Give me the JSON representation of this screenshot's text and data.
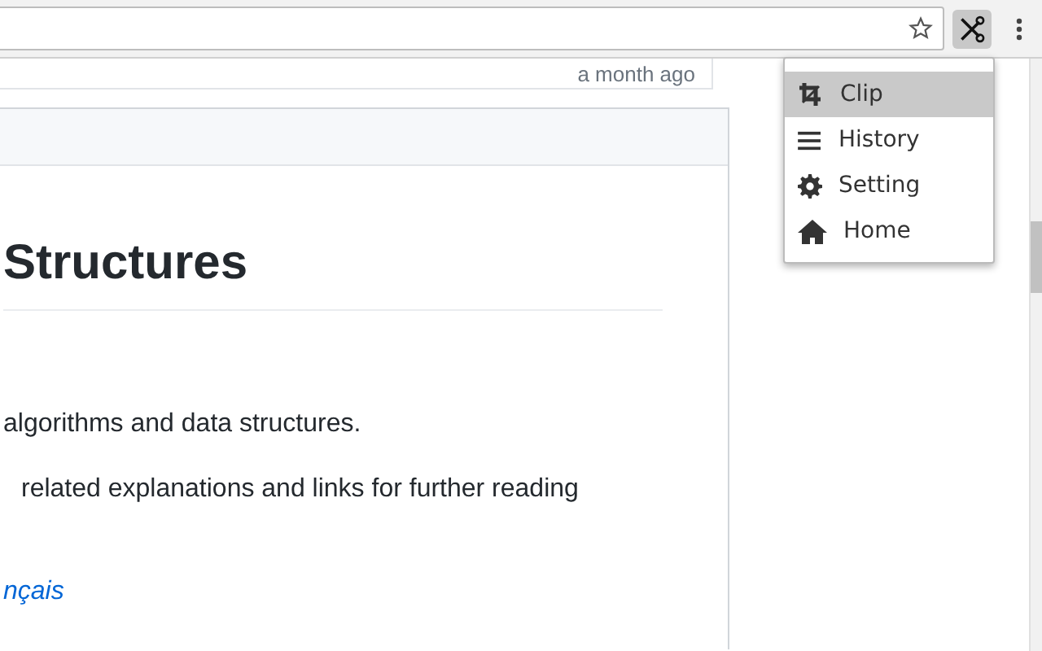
{
  "toolbar": {
    "bookmarked": false
  },
  "page": {
    "timestamp": "a month ago",
    "heading": "Structures",
    "paragraphs": [
      "algorithms and data structures.",
      "related explanations and links for further reading"
    ],
    "link": "nçais"
  },
  "menu": {
    "items": [
      {
        "label": "Clip",
        "kind": "crop",
        "selected": true
      },
      {
        "label": "History",
        "kind": "list",
        "selected": false
      },
      {
        "label": "Setting",
        "kind": "gear",
        "selected": false
      },
      {
        "label": "Home",
        "kind": "home",
        "selected": false
      }
    ]
  }
}
